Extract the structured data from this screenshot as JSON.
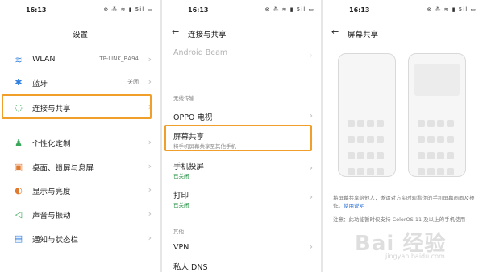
{
  "status": {
    "time": "16:13",
    "icons": "⊗ ⁂ ≋ ▮ 5il ▭"
  },
  "settings": {
    "title": "设置",
    "items": [
      {
        "icon": "wifi-icon",
        "glyph": "≋",
        "label": "WLAN",
        "value": "TP-LINK_BA94",
        "color": "#2f7fe0"
      },
      {
        "icon": "bluetooth-icon",
        "glyph": "✱",
        "label": "蓝牙",
        "value": "关闭",
        "color": "#2f7fe0"
      },
      {
        "icon": "connection-share-icon",
        "glyph": "◌",
        "label": "连接与共享",
        "value": "",
        "color": "#3aa85a"
      },
      {
        "icon": "personalize-icon",
        "glyph": "♟",
        "label": "个性化定制",
        "value": "",
        "color": "#3aa85a"
      },
      {
        "icon": "desktop-lock-icon",
        "glyph": "▣",
        "label": "桌面、锁屏与息屏",
        "value": "",
        "color": "#e07a2f"
      },
      {
        "icon": "display-brightness-icon",
        "glyph": "◐",
        "label": "显示与亮度",
        "value": "",
        "color": "#e07a2f"
      },
      {
        "icon": "sound-vibration-icon",
        "glyph": "◁",
        "label": "声音与振动",
        "value": "",
        "color": "#3aa85a"
      },
      {
        "icon": "notification-bar-icon",
        "glyph": "▤",
        "label": "通知与状态栏",
        "value": "",
        "color": "#2f7fe0"
      }
    ]
  },
  "share": {
    "title": "连接与共享",
    "faded_item": "Android Beam",
    "section_wireless": "无线传输",
    "oppo_tv": "OPPO 电视",
    "screen_share": {
      "label": "屏幕共享",
      "sub": "将手机屏幕共享至其他手机"
    },
    "cast": {
      "label": "手机投屏",
      "sub": "已关闭"
    },
    "print": {
      "label": "打印",
      "sub": "已关闭"
    },
    "section_other": "其他",
    "vpn": "VPN",
    "private_dns": "私人 DNS"
  },
  "screen_share_page": {
    "title": "屏幕共享",
    "description": "将屏幕共享给他人，邀请对方实时观看你的手机屏幕画面及操作。",
    "link": "使用说明",
    "note": "注意：此功能暂时仅支持 ColorOS 11 及以上的手机使用"
  },
  "watermark": {
    "main": "Bai 经验",
    "sub": "jingyan.baidu.com"
  },
  "colors": {
    "highlight": "#f0a02a",
    "background": "#ffffff"
  }
}
